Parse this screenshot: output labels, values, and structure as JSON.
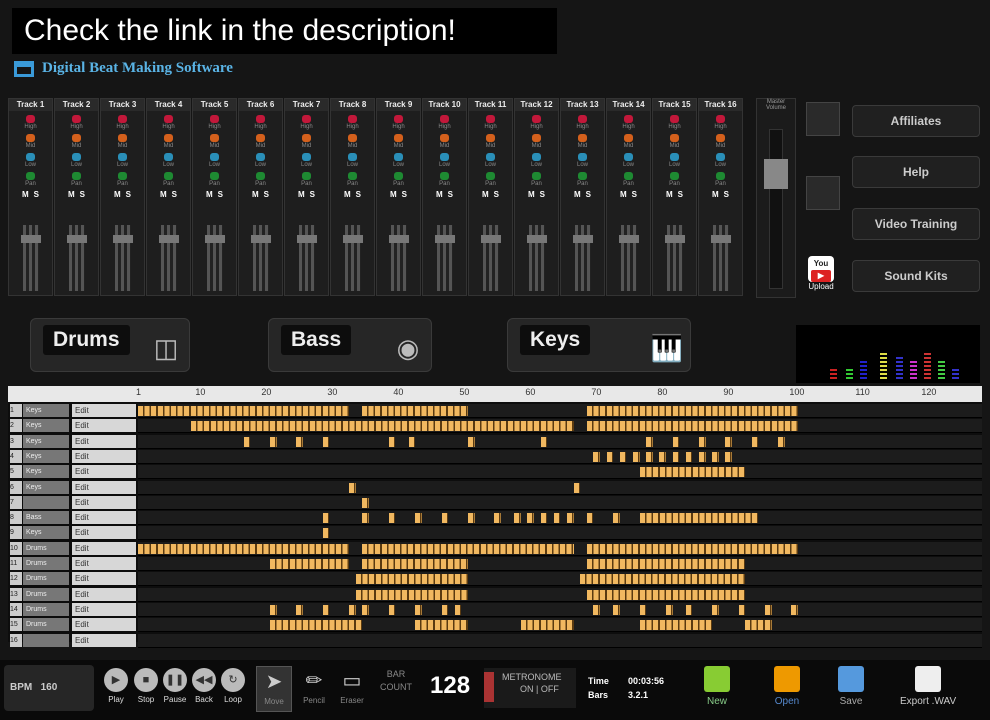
{
  "banner": "Check the link in the description!",
  "brand": "Digital Beat Making Software",
  "mixer": {
    "tracks": [
      "Track 1",
      "Track 2",
      "Track 3",
      "Track 4",
      "Track 5",
      "Track 6",
      "Track 7",
      "Track 8",
      "Track 9",
      "Track 10",
      "Track 11",
      "Track 12",
      "Track 13",
      "Track 14",
      "Track 15",
      "Track 16"
    ],
    "knob_labels": [
      "High",
      "Mid",
      "Low",
      "Pan"
    ],
    "mute": "M",
    "solo": "S",
    "master_label": "Master Volume"
  },
  "side_menu": [
    "Affiliates",
    "Help",
    "Video Training",
    "Sound Kits"
  ],
  "youtube": {
    "icon_text": "You",
    "upload": "Upload"
  },
  "instruments": [
    "Drums",
    "Bass",
    "Keys"
  ],
  "ruler": [
    "1",
    "10",
    "20",
    "30",
    "40",
    "50",
    "60",
    "70",
    "80",
    "90",
    "100",
    "110",
    "120"
  ],
  "tracks": [
    {
      "num": "1",
      "name": "Keys",
      "edit": "Edit",
      "notes": [
        [
          1,
          33
        ],
        [
          35,
          51
        ],
        [
          69,
          101
        ]
      ]
    },
    {
      "num": "2",
      "name": "Keys",
      "edit": "Edit",
      "notes": [
        [
          9,
          67
        ],
        [
          69,
          101
        ]
      ]
    },
    {
      "num": "3",
      "name": "Keys",
      "edit": "Edit",
      "notes": [
        [
          17,
          18
        ],
        [
          21,
          22
        ],
        [
          25,
          26
        ],
        [
          29,
          30
        ],
        [
          39,
          40
        ],
        [
          42,
          43
        ],
        [
          51,
          52
        ],
        [
          62,
          63
        ],
        [
          78,
          79
        ],
        [
          82,
          83
        ],
        [
          86,
          87
        ],
        [
          90,
          91
        ],
        [
          94,
          95
        ],
        [
          98,
          99
        ]
      ]
    },
    {
      "num": "4",
      "name": "Keys",
      "edit": "Edit",
      "notes": [
        [
          70,
          71
        ],
        [
          72,
          73
        ],
        [
          74,
          75
        ],
        [
          76,
          77
        ],
        [
          78,
          79
        ],
        [
          80,
          81
        ],
        [
          82,
          83
        ],
        [
          84,
          85
        ],
        [
          86,
          87
        ],
        [
          88,
          89
        ],
        [
          90,
          91
        ]
      ]
    },
    {
      "num": "5",
      "name": "Keys",
      "edit": "Edit",
      "notes": [
        [
          77,
          93
        ]
      ]
    },
    {
      "num": "6",
      "name": "Keys",
      "edit": "Edit",
      "notes": [
        [
          33,
          34
        ],
        [
          67,
          68
        ]
      ]
    },
    {
      "num": "7",
      "name": "",
      "edit": "Edit",
      "notes": [
        [
          35,
          36
        ]
      ]
    },
    {
      "num": "8",
      "name": "Bass",
      "edit": "Edit",
      "notes": [
        [
          29,
          30
        ],
        [
          35,
          36
        ],
        [
          39,
          40
        ],
        [
          43,
          44
        ],
        [
          47,
          48
        ],
        [
          51,
          52
        ],
        [
          55,
          56
        ],
        [
          58,
          59
        ],
        [
          60,
          61
        ],
        [
          62,
          63
        ],
        [
          64,
          65
        ],
        [
          66,
          67
        ],
        [
          69,
          70
        ],
        [
          73,
          74
        ],
        [
          77,
          95
        ]
      ]
    },
    {
      "num": "9",
      "name": "Keys",
      "edit": "Edit",
      "notes": [
        [
          29,
          30
        ]
      ]
    },
    {
      "num": "10",
      "name": "Drums",
      "edit": "Edit",
      "notes": [
        [
          1,
          33
        ],
        [
          35,
          67
        ],
        [
          69,
          101
        ]
      ]
    },
    {
      "num": "11",
      "name": "Drums",
      "edit": "Edit",
      "notes": [
        [
          21,
          33
        ],
        [
          35,
          51
        ],
        [
          69,
          93
        ]
      ]
    },
    {
      "num": "12",
      "name": "Drums",
      "edit": "Edit",
      "notes": [
        [
          34,
          51
        ],
        [
          68,
          93
        ]
      ]
    },
    {
      "num": "13",
      "name": "Drums",
      "edit": "Edit",
      "notes": [
        [
          34,
          51
        ],
        [
          69,
          93
        ]
      ]
    },
    {
      "num": "14",
      "name": "Drums",
      "edit": "Edit",
      "notes": [
        [
          21,
          22
        ],
        [
          25,
          26
        ],
        [
          29,
          30
        ],
        [
          33,
          34
        ],
        [
          35,
          36
        ],
        [
          39,
          40
        ],
        [
          43,
          44
        ],
        [
          47,
          48
        ],
        [
          49,
          50
        ],
        [
          70,
          71
        ],
        [
          73,
          74
        ],
        [
          77,
          78
        ],
        [
          81,
          82
        ],
        [
          84,
          85
        ],
        [
          88,
          89
        ],
        [
          92,
          93
        ],
        [
          96,
          97
        ],
        [
          100,
          101
        ]
      ]
    },
    {
      "num": "15",
      "name": "Drums",
      "edit": "Edit",
      "notes": [
        [
          21,
          35
        ],
        [
          43,
          51
        ],
        [
          59,
          67
        ],
        [
          77,
          88
        ],
        [
          93,
          97
        ]
      ]
    },
    {
      "num": "16",
      "name": "",
      "edit": "Edit",
      "notes": []
    }
  ],
  "transport": {
    "bpm_label": "BPM",
    "bpm": "160",
    "buttons": [
      "Play",
      "Stop",
      "Pause",
      "Back",
      "Loop"
    ],
    "tools": [
      "Move",
      "Pencil",
      "Eraser"
    ],
    "bar_count_label1": "BAR",
    "bar_count_label2": "COUNT",
    "bar_count": "128",
    "metronome": "METRONOME",
    "metro_on": "ON",
    "metro_off": "OFF",
    "time_label": "Time",
    "time": "00:03:56",
    "bars_label": "Bars",
    "bars": "3.2.1"
  },
  "file": [
    "New",
    "Open",
    "Save",
    "Export .WAV"
  ],
  "colors": {
    "note": "#f1b860",
    "accent": "#5ab4e6"
  }
}
